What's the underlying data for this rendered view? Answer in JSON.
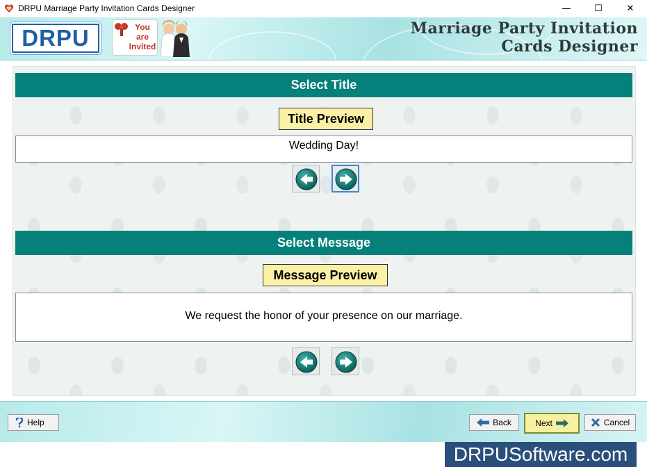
{
  "window": {
    "title": "DRPU Marriage Party Invitation Cards Designer",
    "controls": {
      "minimize": "—",
      "maximize": "☐",
      "close": "✕"
    }
  },
  "banner": {
    "logo_text": "DRPU",
    "invite_lines": [
      "You",
      "are",
      "Invited"
    ],
    "heading_line1": "Marriage Party Invitation",
    "heading_line2": "Cards Designer"
  },
  "title_section": {
    "header": "Select Title",
    "preview_label": "Title Preview",
    "preview_text": "Wedding Day!"
  },
  "message_section": {
    "header": "Select Message",
    "preview_label": "Message Preview",
    "preview_text": "We request the honor of your presence on our marriage."
  },
  "footer": {
    "help_label": "Help",
    "back_label": "Back",
    "next_label": "Next",
    "cancel_label": "Cancel"
  },
  "watermark": "DRPUSoftware.com",
  "colors": {
    "section_header": "#06807a",
    "preview_label_bg": "#fbf1a6",
    "next_button_bg": "#f6f0a0",
    "logo_blue": "#1f5fa8"
  }
}
